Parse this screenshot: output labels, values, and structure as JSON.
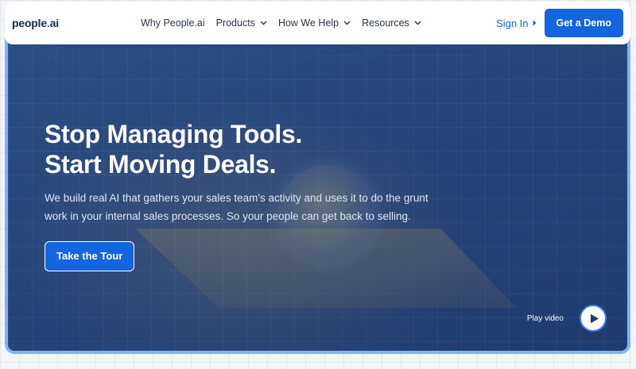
{
  "nav": {
    "logo_text": "people",
    "logo_dot": ".",
    "logo_suffix": "ai",
    "items": [
      {
        "label": "Why People.ai",
        "has_dropdown": false
      },
      {
        "label": "Products",
        "has_dropdown": true
      },
      {
        "label": "How We Help",
        "has_dropdown": true
      },
      {
        "label": "Resources",
        "has_dropdown": true
      }
    ],
    "sign_in": "Sign In",
    "cta": "Get a Demo"
  },
  "hero": {
    "headline_line1": "Stop Managing Tools.",
    "headline_line2": "Start Moving Deals.",
    "subtext": "We build real AI that gathers your sales team's activity and uses it to do the grunt work in your internal sales processes. So your people can get back to selling.",
    "tour_button": "Take the Tour",
    "play_label": "Play video"
  },
  "icons": {
    "chevron": "chevron-down-icon",
    "caret": "caret-right-icon",
    "play": "play-icon"
  },
  "colors": {
    "brand_blue": "#1565e0",
    "hero_bg": "#27467a",
    "hero_border": "#7fb3f5"
  }
}
